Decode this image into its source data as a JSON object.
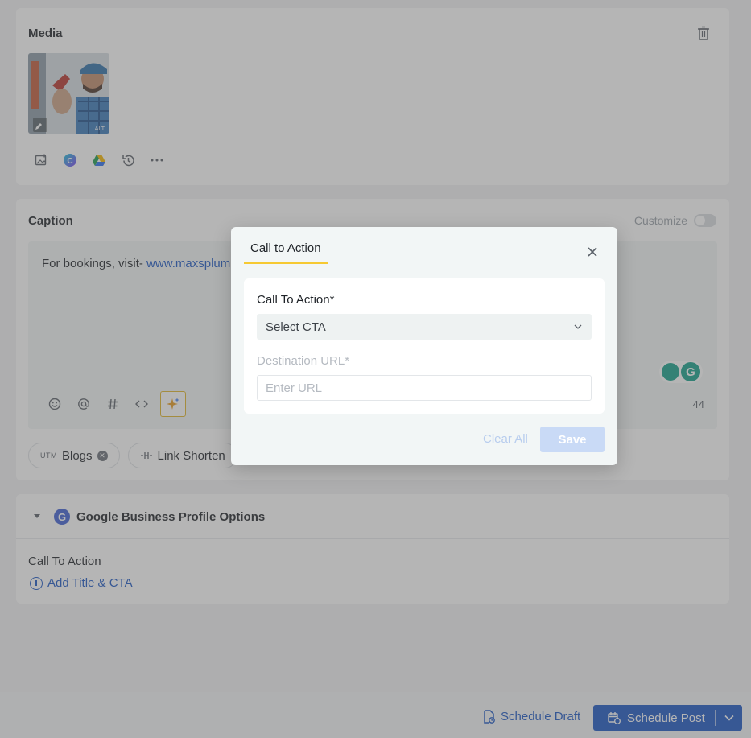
{
  "media": {
    "title": "Media",
    "thumbnail_badge": "ALT",
    "tools": [
      "add-image-icon",
      "canva-icon",
      "google-drive-icon",
      "history-icon",
      "more-icon"
    ]
  },
  "caption": {
    "title": "Caption",
    "customize_label": "Customize",
    "text_prefix": "For bookings, visit- ",
    "link_text": "www.maxsplum",
    "char_count": "44",
    "tools": [
      "emoji-icon",
      "mention-icon",
      "hashtag-icon",
      "code-icon",
      "ai-sparkle-icon"
    ],
    "pills": {
      "utm_tag": "UTM",
      "utm_label": "Blogs",
      "link_shortener_label": "Link Shorten"
    }
  },
  "gbp": {
    "title": "Google Business Profile Options",
    "logo_letter": "G",
    "cta_label": "Call To Action",
    "add_cta_label": "Add Title & CTA"
  },
  "footer": {
    "draft_label": "Schedule Draft",
    "post_label": "Schedule Post"
  },
  "modal": {
    "tab_label": "Call to Action",
    "cta_field_label": "Call To Action*",
    "cta_select_value": "Select CTA",
    "url_field_label": "Destination URL*",
    "url_placeholder": "Enter URL",
    "clear_label": "Clear All",
    "save_label": "Save"
  },
  "colors": {
    "accent": "#1b56c4",
    "tab_underline": "#f6c932",
    "grammarly": "#15a08a"
  }
}
